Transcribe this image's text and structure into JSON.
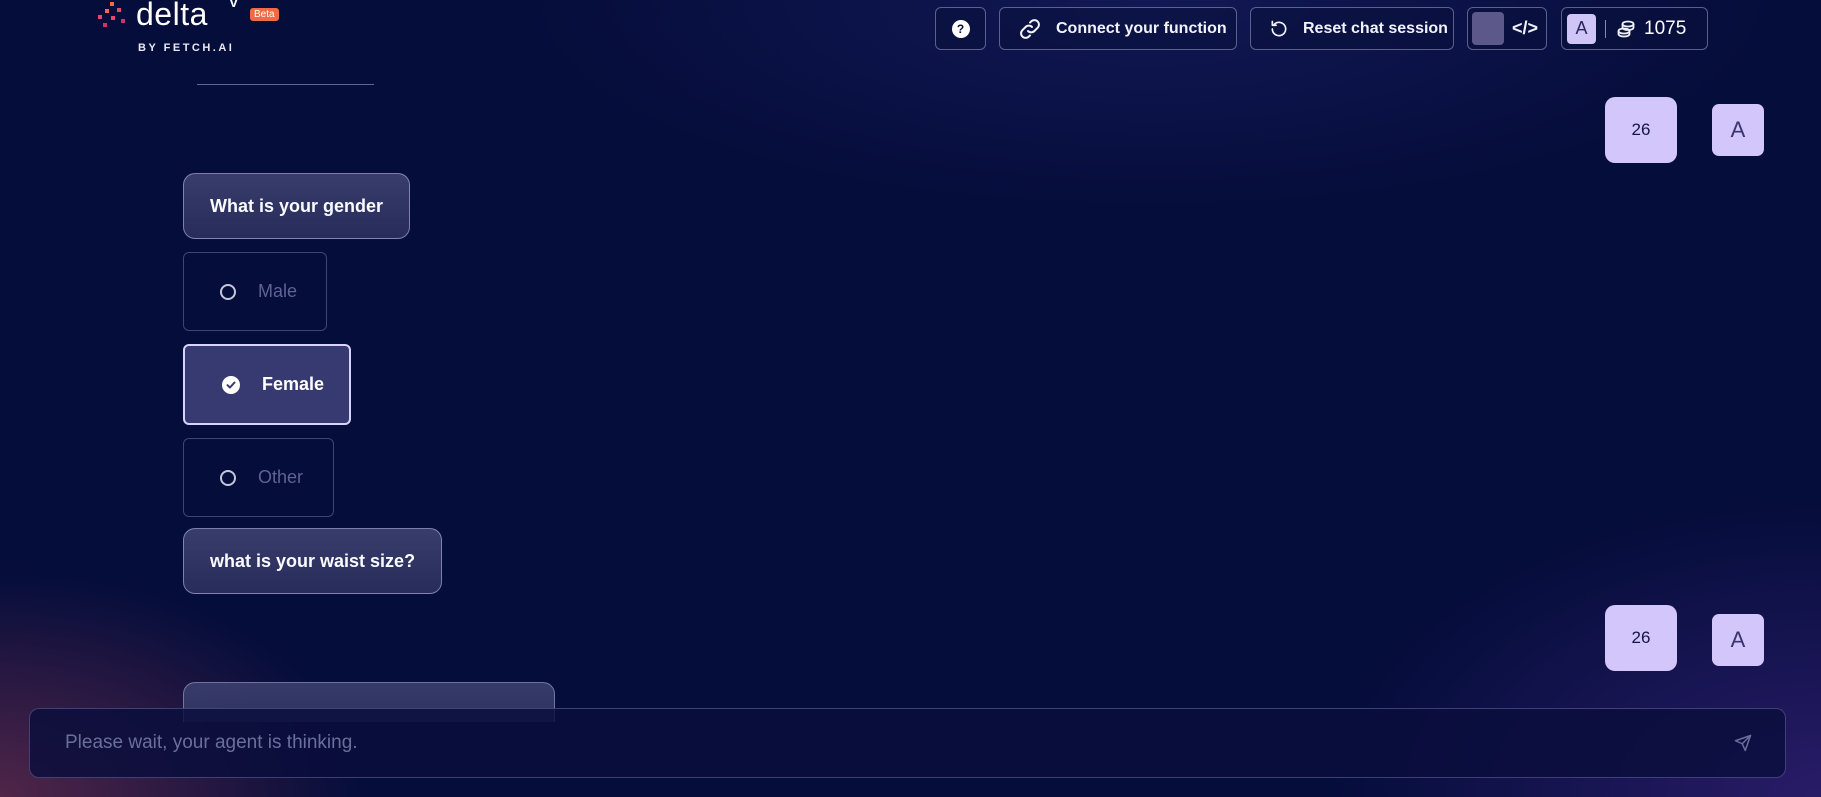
{
  "logo": {
    "wordmark": "delta",
    "superscript": "V",
    "badge": "Beta",
    "subtitle": "BY FETCH.AI"
  },
  "topbar": {
    "help_icon": "question-circle-icon",
    "help_glyph": "?",
    "connect_label": "Connect your function",
    "reset_label": "Reset chat session",
    "code_glyph": "</>",
    "avatar_initial": "A",
    "credits": "1075"
  },
  "chat": {
    "user_messages": [
      {
        "text": "26",
        "avatar": "A"
      },
      {
        "text": "26",
        "avatar": "A"
      }
    ],
    "agent_messages": [
      {
        "text": "What is your gender"
      },
      {
        "text": "what is your waist size?"
      }
    ],
    "gender_options": [
      {
        "label": "Male",
        "selected": false
      },
      {
        "label": "Female",
        "selected": true
      },
      {
        "label": "Other",
        "selected": false
      }
    ]
  },
  "input": {
    "placeholder": "Please wait, your agent is thinking.",
    "value": "",
    "send_icon": "send-icon"
  },
  "colors": {
    "background": "#050d3b",
    "user_bubble": "#d2c6fa",
    "beta_badge": "#f06a45",
    "selected_option": "#363a71"
  }
}
